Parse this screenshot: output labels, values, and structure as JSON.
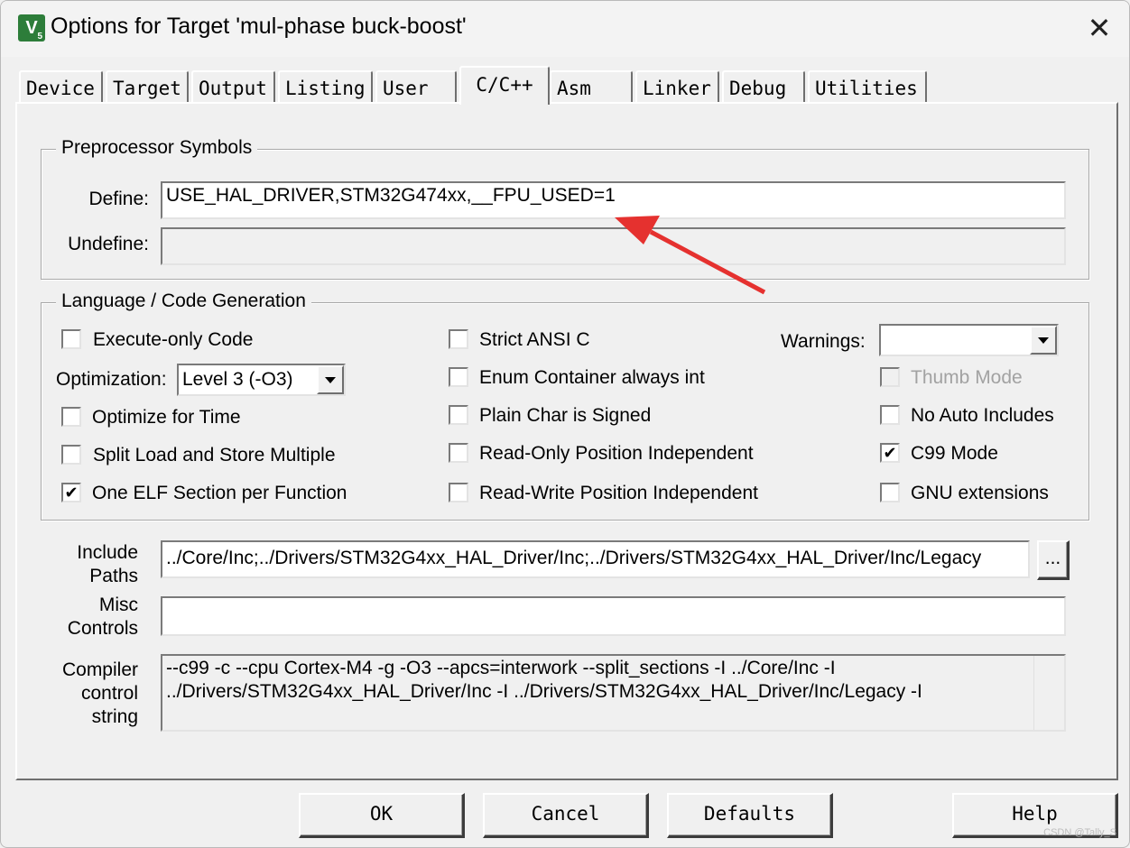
{
  "window": {
    "title": "Options for Target 'mul-phase buck-boost'",
    "close_glyph": "✕",
    "icon_letter": "V",
    "icon_sub": "5"
  },
  "tabs": [
    {
      "label": "Device"
    },
    {
      "label": "Target"
    },
    {
      "label": "Output"
    },
    {
      "label": "Listing"
    },
    {
      "label": "User"
    },
    {
      "label": "C/C++",
      "active": true
    },
    {
      "label": "Asm"
    },
    {
      "label": "Linker"
    },
    {
      "label": "Debug"
    },
    {
      "label": "Utilities"
    }
  ],
  "preprocessor": {
    "group_title": "Preprocessor Symbols",
    "define_label": "Define:",
    "define_value": "USE_HAL_DRIVER,STM32G474xx,__FPU_USED=1",
    "undefine_label": "Undefine:",
    "undefine_value": ""
  },
  "language": {
    "group_title": "Language / Code Generation",
    "execute_only": {
      "label": "Execute-only Code",
      "checked": false
    },
    "optimization_label": "Optimization:",
    "optimization_value": "Level 3 (-O3)",
    "optimize_time": {
      "label": "Optimize for Time",
      "checked": false
    },
    "split_load": {
      "label": "Split Load and Store Multiple",
      "checked": false
    },
    "one_elf": {
      "label": "One ELF Section per Function",
      "checked": true
    },
    "strict_ansi": {
      "label": "Strict ANSI C",
      "checked": false
    },
    "enum_container": {
      "label": "Enum Container always int",
      "checked": false
    },
    "plain_char": {
      "label": "Plain Char is Signed",
      "checked": false
    },
    "ro_pi": {
      "label": "Read-Only Position Independent",
      "checked": false
    },
    "rw_pi": {
      "label": "Read-Write Position Independent",
      "checked": false
    },
    "warnings_label": "Warnings:",
    "warnings_value": "",
    "thumb_mode": {
      "label": "Thumb Mode",
      "checked": false,
      "disabled": true
    },
    "no_auto_includes": {
      "label": "No Auto Includes",
      "checked": false
    },
    "c99_mode": {
      "label": "C99 Mode",
      "checked": true
    },
    "gnu_ext": {
      "label": "GNU extensions",
      "checked": false
    },
    "check_glyph": "✔"
  },
  "paths": {
    "include_label_1": "Include",
    "include_label_2": "Paths",
    "include_value": "../Core/Inc;../Drivers/STM32G4xx_HAL_Driver/Inc;../Drivers/STM32G4xx_HAL_Driver/Inc/Legacy",
    "browse_label": "...",
    "misc_label_1": "Misc",
    "misc_label_2": "Controls",
    "misc_value": "",
    "compiler_label_1": "Compiler",
    "compiler_label_2": "control",
    "compiler_label_3": "string",
    "compiler_line_1": "--c99 -c --cpu Cortex-M4 -g -O3 --apcs=interwork --split_sections -I ../Core/Inc -I",
    "compiler_line_2": "../Drivers/STM32G4xx_HAL_Driver/Inc -I ../Drivers/STM32G4xx_HAL_Driver/Inc/Legacy -I"
  },
  "buttons": {
    "ok": "OK",
    "cancel": "Cancel",
    "defaults": "Defaults",
    "help": "Help"
  },
  "watermark": "CSDN @Tally_S",
  "colors": {
    "annotation_arrow": "#e5312f",
    "icon_green": "#2d7d3a"
  }
}
